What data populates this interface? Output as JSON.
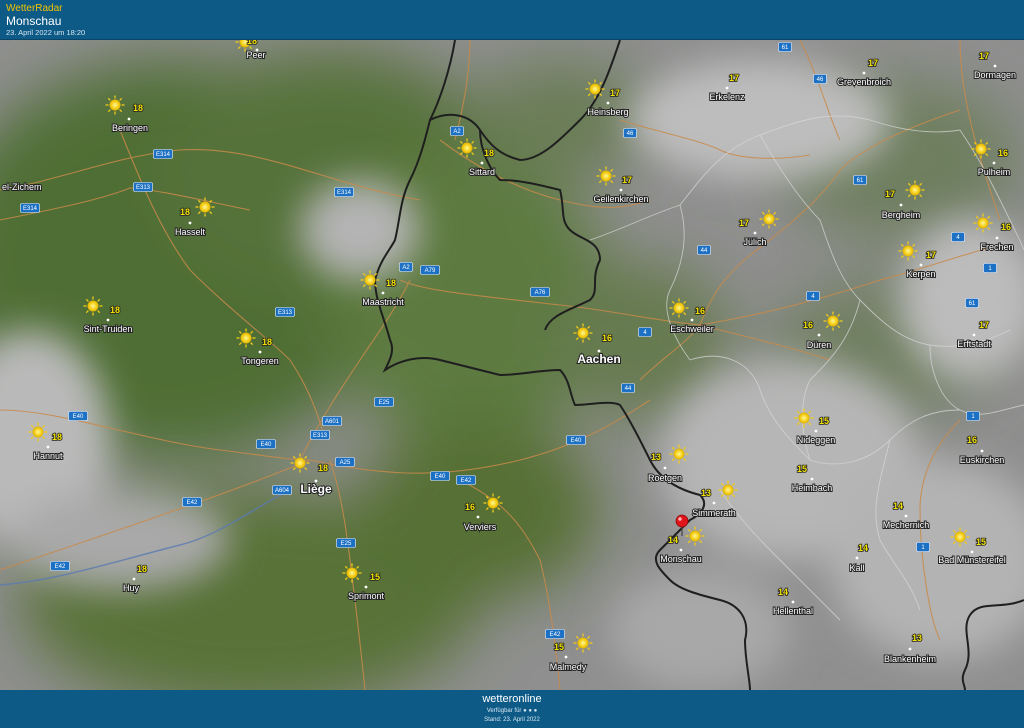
{
  "header": {
    "brand": "WetterRadar",
    "location": "Monschau",
    "datetime": "23. April 2022 um 18:20"
  },
  "footer": {
    "logo": "wetteronline",
    "available": "Verfügbar für ● ● ●",
    "stand": "Stand: 23. April 2022"
  },
  "cities": [
    {
      "name": "Peer",
      "temp": "18",
      "sunny": true,
      "big": false
    },
    {
      "name": "Beringen",
      "temp": "18",
      "sunny": true,
      "big": false
    },
    {
      "name": "el-Zichem",
      "temp": "",
      "sunny": false,
      "big": false
    },
    {
      "name": "Hasselt",
      "temp": "18",
      "sunny": true,
      "big": false
    },
    {
      "name": "Sint-Truiden",
      "temp": "18",
      "sunny": true,
      "big": false
    },
    {
      "name": "Tongeren",
      "temp": "18",
      "sunny": true,
      "big": false
    },
    {
      "name": "Hannut",
      "temp": "18",
      "sunny": true,
      "big": false
    },
    {
      "name": "Huy",
      "temp": "18",
      "sunny": false,
      "big": false
    },
    {
      "name": "Maastricht",
      "temp": "18",
      "sunny": true,
      "big": false
    },
    {
      "name": "Sittard",
      "temp": "18",
      "sunny": true,
      "big": false
    },
    {
      "name": "Liège",
      "temp": "18",
      "sunny": true,
      "big": true
    },
    {
      "name": "Verviers",
      "temp": "16",
      "sunny": true,
      "big": false
    },
    {
      "name": "Sprimont",
      "temp": "15",
      "sunny": true,
      "big": false
    },
    {
      "name": "Malmedy",
      "temp": "15",
      "sunny": true,
      "big": false
    },
    {
      "name": "Heinsberg",
      "temp": "17",
      "sunny": true,
      "big": false
    },
    {
      "name": "Geilenkirchen",
      "temp": "17",
      "sunny": true,
      "big": false
    },
    {
      "name": "Erkelenz",
      "temp": "17",
      "sunny": false,
      "big": false
    },
    {
      "name": "Aachen",
      "temp": "16",
      "sunny": true,
      "big": true
    },
    {
      "name": "Eschweiler",
      "temp": "16",
      "sunny": true,
      "big": false
    },
    {
      "name": "Jülich",
      "temp": "17",
      "sunny": true,
      "big": false
    },
    {
      "name": "Roetgen",
      "temp": "13",
      "sunny": true,
      "big": false
    },
    {
      "name": "Simmerath",
      "temp": "13",
      "sunny": true,
      "big": false
    },
    {
      "name": "Monschau",
      "temp": "14",
      "sunny": true,
      "big": false
    },
    {
      "name": "Düren",
      "temp": "16",
      "sunny": true,
      "big": false
    },
    {
      "name": "Nideggen",
      "temp": "15",
      "sunny": true,
      "big": false
    },
    {
      "name": "Heimbach",
      "temp": "15",
      "sunny": false,
      "big": false
    },
    {
      "name": "Hellenthal",
      "temp": "14",
      "sunny": false,
      "big": false
    },
    {
      "name": "Grevenbroich",
      "temp": "17",
      "sunny": false,
      "big": false
    },
    {
      "name": "Dormagen",
      "temp": "17",
      "sunny": false,
      "big": false
    },
    {
      "name": "Pulheim",
      "temp": "16",
      "sunny": true,
      "big": false
    },
    {
      "name": "Bergheim",
      "temp": "17",
      "sunny": true,
      "big": false
    },
    {
      "name": "Frechen",
      "temp": "16",
      "sunny": true,
      "big": false
    },
    {
      "name": "Kerpen",
      "temp": "17",
      "sunny": true,
      "big": false
    },
    {
      "name": "Erftstadt",
      "temp": "17",
      "sunny": false,
      "big": false
    },
    {
      "name": "Euskirchen",
      "temp": "16",
      "sunny": false,
      "big": false
    },
    {
      "name": "Mechernich",
      "temp": "14",
      "sunny": false,
      "big": false
    },
    {
      "name": "Kall",
      "temp": "14",
      "sunny": false,
      "big": false
    },
    {
      "name": "Bad Münstereifel",
      "temp": "15",
      "sunny": true,
      "big": false
    },
    {
      "name": "Blankenheim",
      "temp": "13",
      "sunny": false,
      "big": false
    }
  ],
  "roads": [
    "E314",
    "E314",
    "E313",
    "E314",
    "E313",
    "E40",
    "E40",
    "E313",
    "A601",
    "E25",
    "A25",
    "A604",
    "E42",
    "E42",
    "E25",
    "E40",
    "E42",
    "E40",
    "E42",
    "A2",
    "A2",
    "A79",
    "A76",
    "61",
    "46",
    "46",
    "61",
    "4",
    "44",
    "44",
    "4",
    "4",
    "61",
    "1",
    "1",
    "1"
  ],
  "marker": {
    "label": "Monschau",
    "color": "#e0151c"
  }
}
